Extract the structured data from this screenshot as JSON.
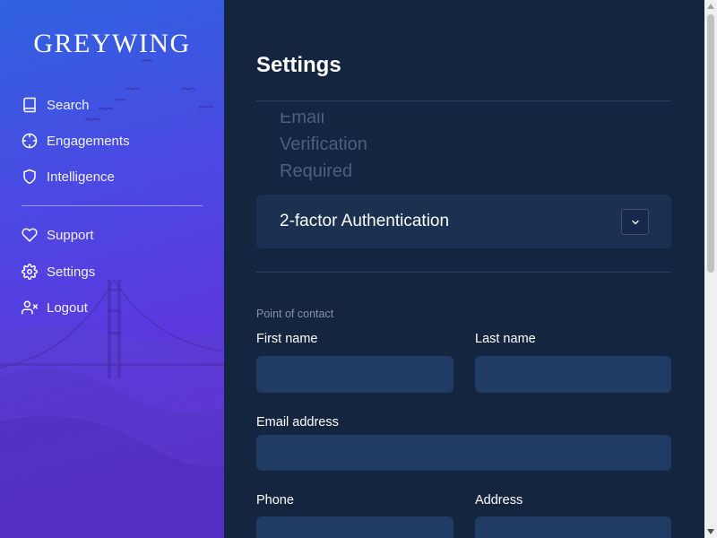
{
  "sidebar": {
    "logo": "GREYWING",
    "items": [
      {
        "label": "Search",
        "icon": "book-icon"
      },
      {
        "label": "Engagements",
        "icon": "crosshair-icon"
      },
      {
        "label": "Intelligence",
        "icon": "shield-icon"
      },
      {
        "label": "Support",
        "icon": "heart-icon"
      },
      {
        "label": "Settings",
        "icon": "gear-icon"
      },
      {
        "label": "Logout",
        "icon": "user-x-icon"
      }
    ]
  },
  "main": {
    "title": "Settings",
    "email_verification": {
      "line1": "Email",
      "line2": "Verification",
      "line3": "Required"
    },
    "two_factor": {
      "label": "2-factor Authentication",
      "icon": "chevron-down-icon"
    },
    "point_of_contact": {
      "section_label": "Point of contact",
      "first_name": {
        "label": "First name",
        "value": ""
      },
      "last_name": {
        "label": "Last name",
        "value": ""
      },
      "email": {
        "label": "Email address",
        "value": ""
      },
      "phone": {
        "label": "Phone",
        "value": ""
      },
      "address": {
        "label": "Address",
        "value": ""
      }
    }
  },
  "colors": {
    "sidebar_gradient_start": "#2f63e0",
    "sidebar_gradient_end": "#6a22d3",
    "main_background": "#14253f",
    "input_background": "#213c64",
    "card_background": "#1a3152"
  }
}
